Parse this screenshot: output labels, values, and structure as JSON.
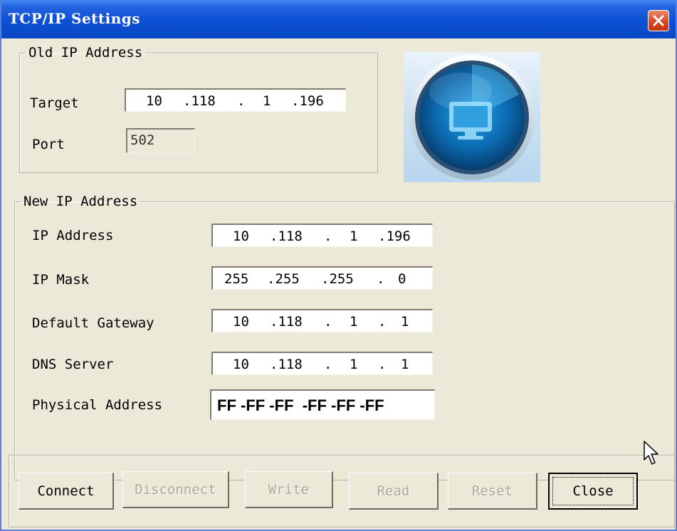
{
  "window": {
    "title": "TCP/IP Settings"
  },
  "old_ip": {
    "legend": "Old IP Address",
    "target_label": "Target",
    "target_octets": [
      "10",
      ".118",
      ".",
      "1",
      ".196"
    ],
    "port_label": "Port",
    "port_value": "502"
  },
  "new_ip": {
    "legend": "New IP Address",
    "ip_label": "IP Address",
    "ip_octets": [
      "10",
      ".118",
      ".",
      "1",
      ".196"
    ],
    "mask_label": "IP Mask",
    "mask_octets": [
      "255",
      ".255",
      ".255",
      ".",
      "0"
    ],
    "gateway_label": "Default Gateway",
    "gateway_octets": [
      "10",
      ".118",
      ".",
      "1",
      ".",
      "1"
    ],
    "dns_label": "DNS Server",
    "dns_octets": [
      "10",
      ".118",
      ".",
      "1",
      ".",
      "1"
    ],
    "mac_label": "Physical Address",
    "mac_value": "FF -FF -FF  -FF -FF -FF"
  },
  "buttons": {
    "connect": "Connect",
    "disconnect": "Disconnect",
    "write": "Write",
    "read": "Read",
    "reset": "Reset",
    "close": "Close"
  },
  "icons": {
    "close": "close-x-icon",
    "logo": "radar-monitor-icon",
    "cursor": "mouse-pointer-icon"
  },
  "colors": {
    "titlebar": "#0b50d4",
    "dialog_bg": "#ece9d8",
    "close_button": "#d4461e",
    "disabled_text": "#aca899"
  }
}
